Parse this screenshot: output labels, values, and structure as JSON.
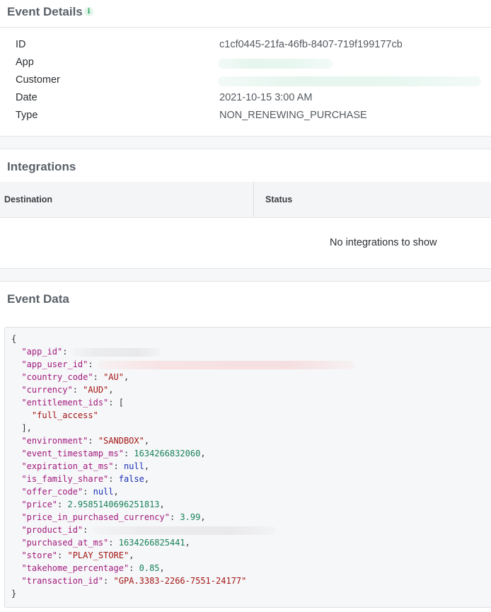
{
  "event_details": {
    "title": "Event Details",
    "info_icon_glyph": "i",
    "rows": [
      {
        "label": "ID",
        "value": "c1cf0445-21fa-46fb-8407-719f199177cb"
      },
      {
        "label": "App",
        "value": ""
      },
      {
        "label": "Customer",
        "value": ""
      },
      {
        "label": "Date",
        "value": "2021-10-15 3:00 AM"
      },
      {
        "label": "Type",
        "value": "NON_RENEWING_PURCHASE"
      }
    ]
  },
  "integrations": {
    "title": "Integrations",
    "columns": [
      "Destination",
      "Status"
    ],
    "empty_message": "No integrations to show"
  },
  "event_data": {
    "title": "Event Data",
    "open_brace": "{",
    "close_brace": "}",
    "fields": {
      "app_id": {
        "key": "\"app_id\"",
        "value": ""
      },
      "app_user_id": {
        "key": "\"app_user_id\"",
        "value": ""
      },
      "country_code": {
        "key": "\"country_code\"",
        "value": "\"AU\""
      },
      "currency": {
        "key": "\"currency\"",
        "value": "\"AUD\""
      },
      "entitlement_ids": {
        "key": "\"entitlement_ids\"",
        "open": "[",
        "item": "\"full_access\"",
        "close": "],"
      },
      "environment": {
        "key": "\"environment\"",
        "value": "\"SANDBOX\""
      },
      "event_timestamp_ms": {
        "key": "\"event_timestamp_ms\"",
        "value": "1634266832060"
      },
      "expiration_at_ms": {
        "key": "\"expiration_at_ms\"",
        "value": "null"
      },
      "is_family_share": {
        "key": "\"is_family_share\"",
        "value": "false"
      },
      "offer_code": {
        "key": "\"offer_code\"",
        "value": "null"
      },
      "price": {
        "key": "\"price\"",
        "value": "2.9585140696251813"
      },
      "price_in_purchased_currency": {
        "key": "\"price_in_purchased_currency\"",
        "value": "3.99"
      },
      "product_id": {
        "key": "\"product_id\"",
        "value": ""
      },
      "purchased_at_ms": {
        "key": "\"purchased_at_ms\"",
        "value": "1634266825441"
      },
      "store": {
        "key": "\"store\"",
        "value": "\"PLAY_STORE\""
      },
      "takehome_percentage": {
        "key": "\"takehome_percentage\"",
        "value": "0.85"
      },
      "transaction_id": {
        "key": "\"transaction_id\"",
        "value": "\"GPA.3383-2266-7551-24177\""
      }
    }
  },
  "colors": {
    "json_key": "#a11a7e",
    "json_string": "#a31515",
    "json_number": "#18825a",
    "json_keyword": "#1a2fb8",
    "info_icon": "#27a561"
  }
}
